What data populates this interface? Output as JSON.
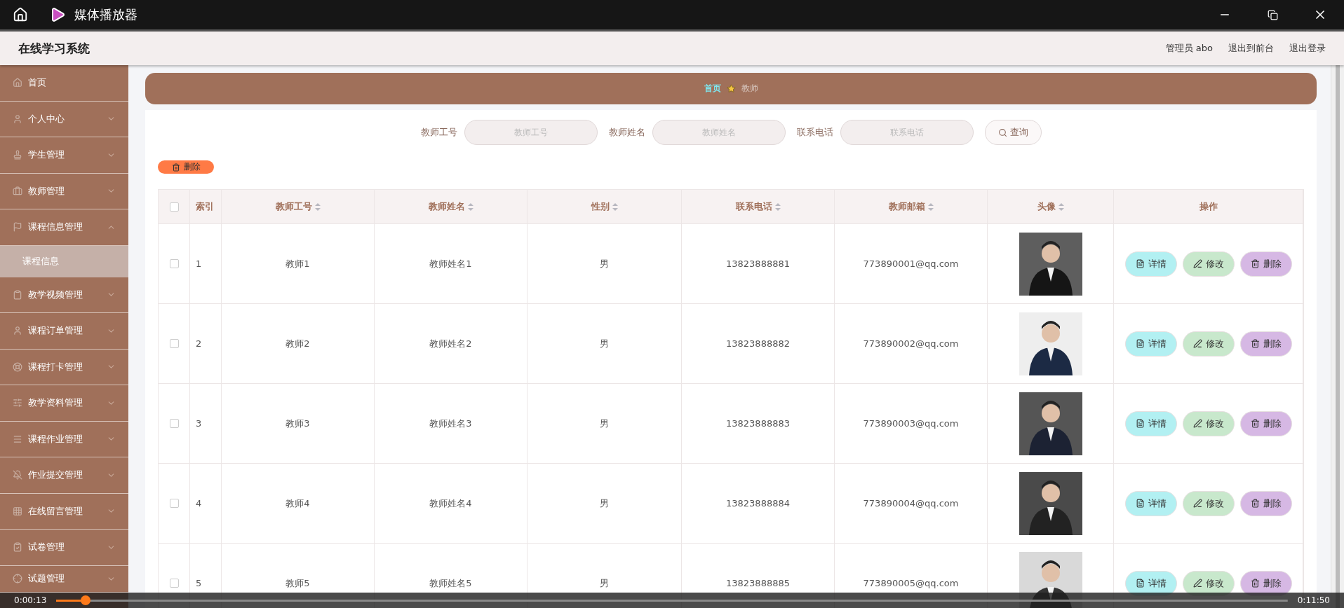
{
  "window": {
    "title": "媒体播放器"
  },
  "header": {
    "title": "在线学习系统",
    "links": [
      "管理员 abo",
      "退出到前台",
      "退出登录"
    ]
  },
  "sidebar": {
    "items": [
      {
        "label": "首页"
      },
      {
        "label": "个人中心",
        "expanded": false
      },
      {
        "label": "学生管理",
        "expanded": false
      },
      {
        "label": "教师管理",
        "expanded": false
      },
      {
        "label": "课程信息管理",
        "expanded": true,
        "children": [
          {
            "label": "课程信息",
            "selected": true
          }
        ]
      },
      {
        "label": "教学视频管理",
        "expanded": false
      },
      {
        "label": "课程订单管理",
        "expanded": false
      },
      {
        "label": "课程打卡管理",
        "expanded": false
      },
      {
        "label": "教学资料管理",
        "expanded": false
      },
      {
        "label": "课程作业管理",
        "expanded": false
      },
      {
        "label": "作业提交管理",
        "expanded": false
      },
      {
        "label": "在线留言管理",
        "expanded": false
      },
      {
        "label": "试卷管理",
        "expanded": false
      },
      {
        "label": "试题管理",
        "expanded": false
      }
    ]
  },
  "breadcrumb": [
    "首页",
    "教师"
  ],
  "search": {
    "fields": [
      {
        "label": "教师工号",
        "placeholder": "教师工号"
      },
      {
        "label": "教师姓名",
        "placeholder": "教师姓名"
      },
      {
        "label": "联系电话",
        "placeholder": "联系电话"
      }
    ],
    "button": "查询"
  },
  "delete_button": "删除",
  "table": {
    "all_checked": false,
    "columns": [
      {
        "label": "索引",
        "sortable": false
      },
      {
        "label": "教师工号",
        "sortable": true
      },
      {
        "label": "教师姓名",
        "sortable": true
      },
      {
        "label": "性别",
        "sortable": true
      },
      {
        "label": "联系电话",
        "sortable": true
      },
      {
        "label": "教师邮箱",
        "sortable": true
      },
      {
        "label": "头像",
        "sortable": true
      },
      {
        "label": "操作",
        "sortable": false
      }
    ],
    "rows": [
      {
        "index": "1",
        "id": "教师1",
        "name": "教师姓名1",
        "gender": "男",
        "phone": "13823888881",
        "email": "773890001@qq.com",
        "checked": false,
        "actions": [
          {
            "kind": "detail",
            "label": "详情"
          },
          {
            "kind": "edit",
            "label": "修改"
          },
          {
            "kind": "delete",
            "label": "删除"
          }
        ]
      },
      {
        "index": "2",
        "id": "教师2",
        "name": "教师姓名2",
        "gender": "男",
        "phone": "13823888882",
        "email": "773890002@qq.com",
        "checked": false,
        "actions": [
          {
            "kind": "detail",
            "label": "详情"
          },
          {
            "kind": "edit",
            "label": "修改"
          },
          {
            "kind": "delete",
            "label": "删除"
          }
        ]
      },
      {
        "index": "3",
        "id": "教师3",
        "name": "教师姓名3",
        "gender": "男",
        "phone": "13823888883",
        "email": "773890003@qq.com",
        "checked": false,
        "actions": [
          {
            "kind": "detail",
            "label": "详情"
          },
          {
            "kind": "edit",
            "label": "修改"
          },
          {
            "kind": "delete",
            "label": "删除"
          }
        ]
      },
      {
        "index": "4",
        "id": "教师4",
        "name": "教师姓名4",
        "gender": "男",
        "phone": "13823888884",
        "email": "773890004@qq.com",
        "checked": false,
        "actions": [
          {
            "kind": "detail",
            "label": "详情"
          },
          {
            "kind": "edit",
            "label": "修改"
          },
          {
            "kind": "delete",
            "label": "删除"
          }
        ]
      },
      {
        "index": "5",
        "id": "教师5",
        "name": "教师姓名5",
        "gender": "男",
        "phone": "13823888885",
        "email": "773890005@qq.com",
        "checked": false,
        "actions": [
          {
            "kind": "detail",
            "label": "详情"
          },
          {
            "kind": "edit",
            "label": "修改"
          },
          {
            "kind": "delete",
            "label": "删除"
          }
        ]
      }
    ]
  },
  "player": {
    "elapsed": "0:00:13",
    "total": "0:11:50",
    "level": 0.02
  }
}
